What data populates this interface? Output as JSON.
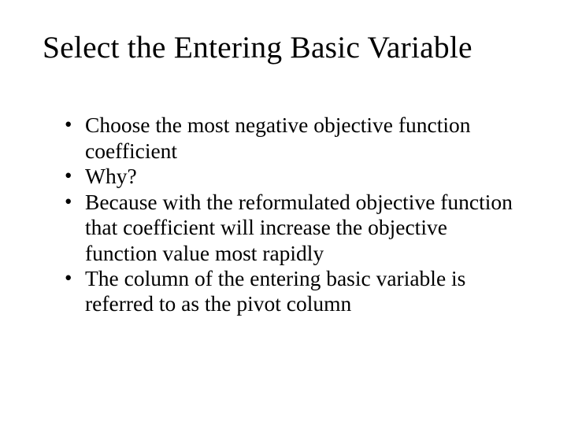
{
  "title": "Select the Entering Basic Variable",
  "bullets": [
    "Choose the most negative objective function coefficient",
    "Why?",
    "Because with the reformulated objective function that coefficient will increase the objective function value most rapidly",
    "The column of the entering basic variable is referred to as the pivot column"
  ]
}
